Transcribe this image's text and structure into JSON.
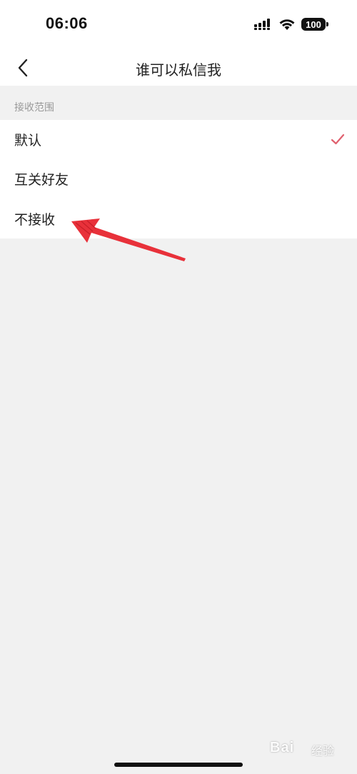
{
  "status_bar": {
    "time": "06:06",
    "battery": "100",
    "icons": [
      "signal-icon",
      "wifi-icon",
      "battery-icon"
    ]
  },
  "nav_bar": {
    "back_icon": "chevron-left-icon",
    "title": "谁可以私信我"
  },
  "section": {
    "label": "接收范围"
  },
  "options": [
    {
      "label": "默认",
      "selected": true
    },
    {
      "label": "互关好友",
      "selected": false
    },
    {
      "label": "不接收",
      "selected": false
    }
  ],
  "colors": {
    "background": "#f1f1f1",
    "panel": "#ffffff",
    "check": "#e0606e",
    "annotation_arrow": "#e8313a",
    "section_label": "#999999"
  },
  "annotation": {
    "icon": "red-arrow-annotation",
    "points_to": "不接收"
  },
  "watermark": {
    "brand": "Bai",
    "sub": "经验"
  }
}
